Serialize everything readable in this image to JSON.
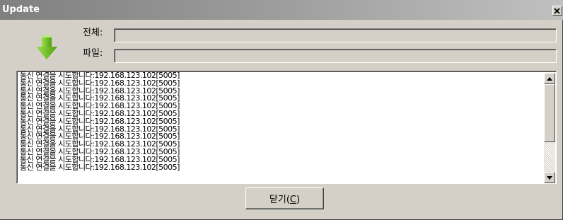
{
  "window": {
    "title": "Update",
    "close_glyph": "✕"
  },
  "icons": {
    "download": "download-arrow-icon",
    "close": "close-icon",
    "scroll_up": "scroll-up-arrow-icon",
    "scroll_down": "scroll-down-arrow-icon"
  },
  "colors": {
    "arrow_green": "#6ac21e",
    "title_bar": "#808080",
    "face": "#d4d0c8"
  },
  "progress": {
    "total_label": "전체:",
    "total_value": 0,
    "file_label": "파일:",
    "file_value": 0
  },
  "log": {
    "lines": [
      "통신 연결을 시도합니다:192.168.123.102[5005]",
      "통신 연결을 시도합니다:192.168.123.102[5005]",
      "통신 연결을 시도합니다:192.168.123.102[5005]",
      "통신 연결을 시도합니다:192.168.123.102[5005]",
      "통신 연결을 시도합니다:192.168.123.102[5005]",
      "통신 연결을 시도합니다:192.168.123.102[5005]",
      "통신 연결을 시도합니다:192.168.123.102[5005]",
      "통신 연결을 시도합니다:192.168.123.102[5005]",
      "통신 연결을 시도합니다:192.168.123.102[5005]",
      "통신 연결을 시도합니다:192.168.123.102[5005]",
      "통신 연결을 시도합니다:192.168.123.102[5005]",
      "통신 연결을 시도합니다:192.168.123.102[5005]",
      "통신 연결을 시도합니다:192.168.123.102[5005]"
    ]
  },
  "buttons": {
    "close_prefix": "닫기(",
    "close_mnemonic": "C",
    "close_suffix": ")"
  }
}
